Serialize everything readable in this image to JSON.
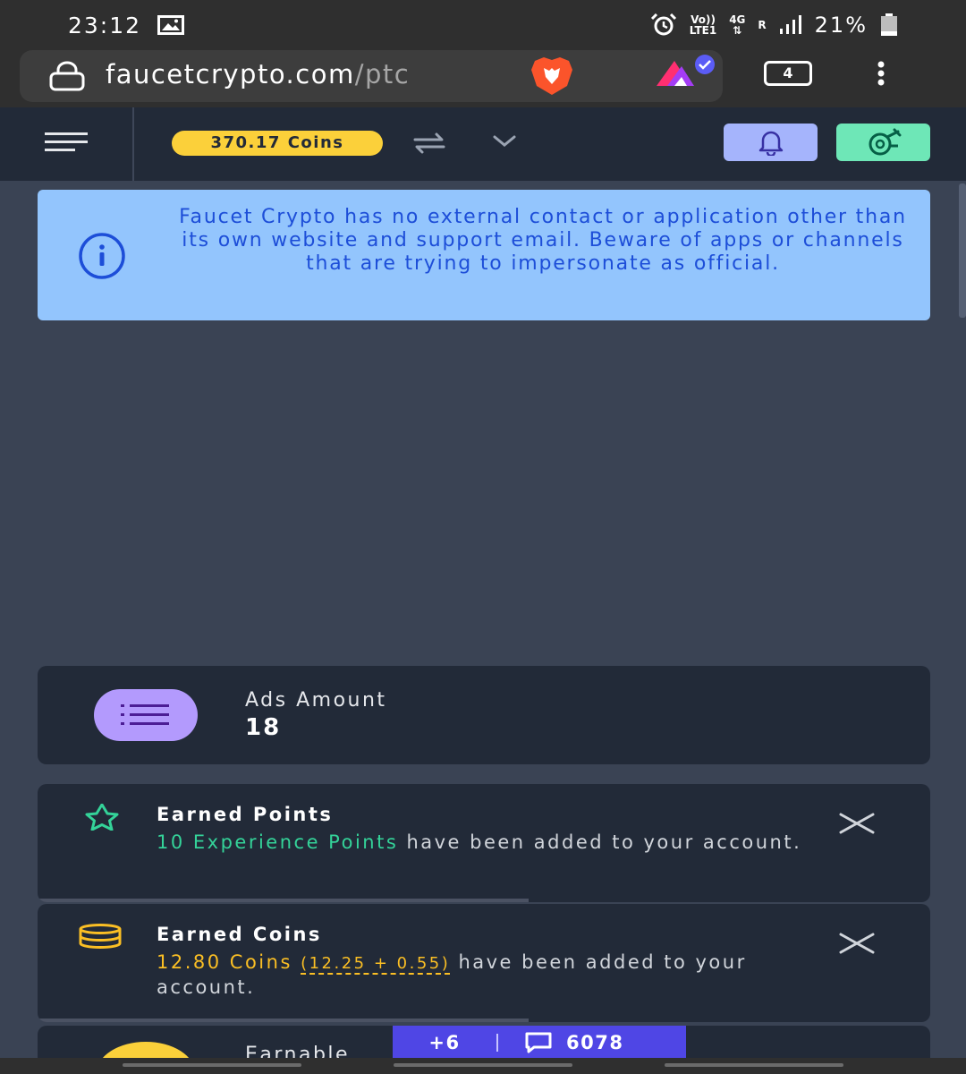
{
  "status_bar": {
    "time": "23:12",
    "battery_percent": "21%",
    "lte_label": "Vo))",
    "lte_sub": "LTE1",
    "network_label": "4G",
    "roaming_label": "R"
  },
  "browser": {
    "url_host": "faucetcrypto.com",
    "url_path": "/ptc",
    "tab_count": "4"
  },
  "header": {
    "coins_balance": "370.17 Coins"
  },
  "notice": {
    "text": "Faucet Crypto has no external contact or application other than its own website and support email. Beware of apps or channels that are trying to impersonate as official."
  },
  "ads": {
    "label": "Ads Amount",
    "value": "18"
  },
  "toasts": {
    "points": {
      "title": "Earned Points",
      "highlight": "10 Experience Points",
      "message": " have been added to your account.",
      "progress": 0.55
    },
    "coins": {
      "title": "Earned Coins",
      "highlight": "12.80 Coins",
      "breakdown": "(12.25 + 0.55)",
      "message": " have been added to your account.",
      "progress": 0.55
    }
  },
  "earnable": {
    "label": "Earnable"
  },
  "chat": {
    "plus_label": "+6",
    "count": "6078"
  },
  "colors": {
    "page_bg": "#3a4354",
    "header_bg": "#222a38",
    "coins_badge": "#fbd03a",
    "info_bg": "#93c5fd",
    "info_text": "#1d4ed8",
    "bell_button": "#a5b4fc",
    "faucet_button": "#6ee7b7",
    "ads_icon_bg": "#b39afd",
    "points_accent": "#34d399",
    "coins_accent": "#fbbf24",
    "chat_bar": "#4f46e5"
  },
  "icons": {
    "status": [
      "image-icon",
      "alarm-icon",
      "signal-icon",
      "battery-icon"
    ],
    "browser": [
      "lock-icon",
      "brave-shield-icon",
      "brave-rewards-icon",
      "kebab-menu-icon"
    ],
    "header": [
      "hamburger-icon",
      "exchange-icon",
      "chevron-down-icon",
      "bell-icon",
      "faucet-icon"
    ],
    "content": [
      "info-icon",
      "list-icon",
      "star-icon",
      "coin-stack-icon",
      "close-icon",
      "chat-icon"
    ]
  }
}
